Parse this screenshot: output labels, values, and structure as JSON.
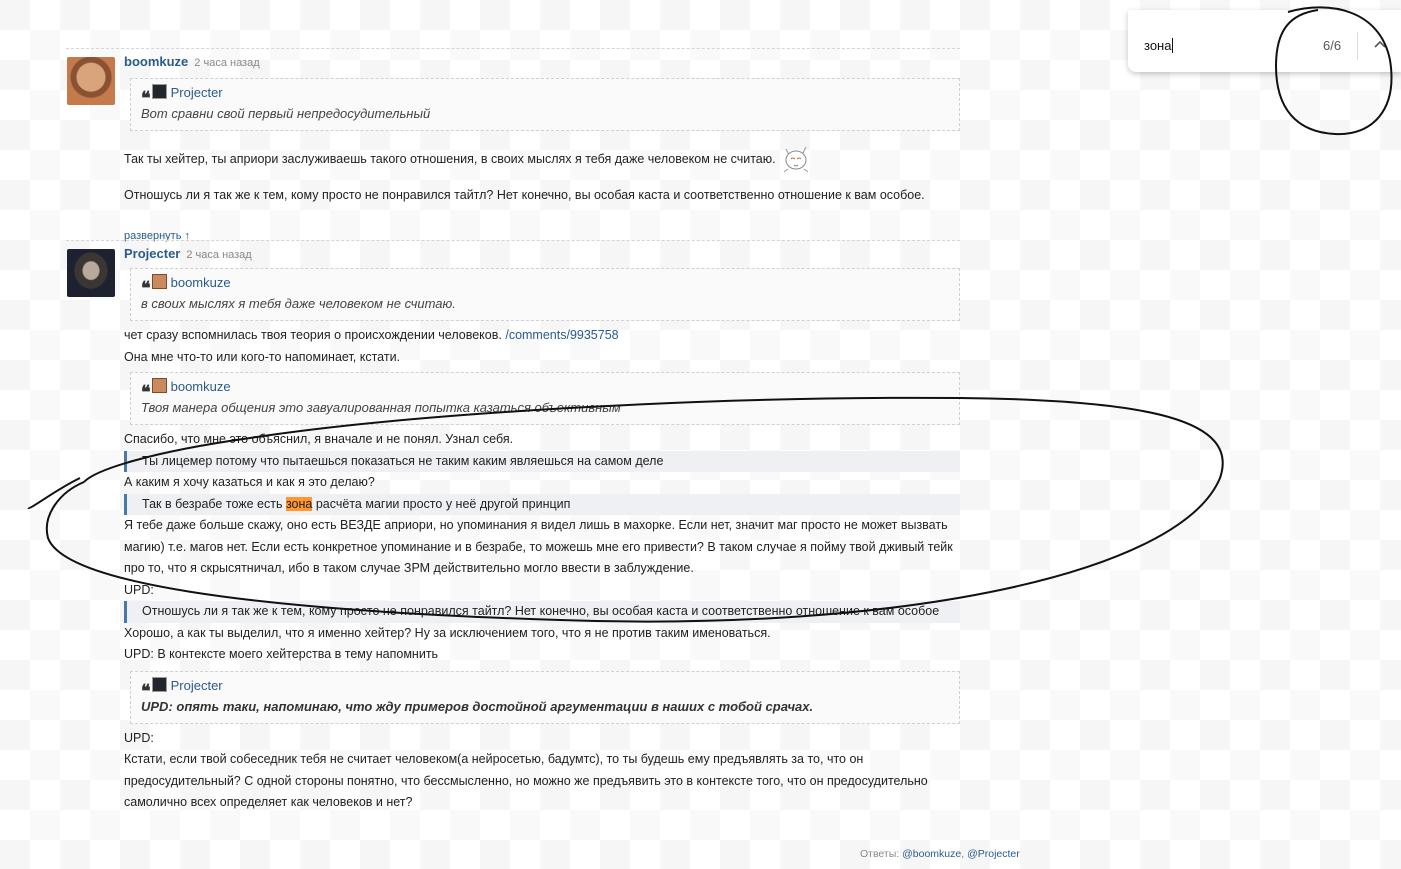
{
  "find_bar": {
    "query": "зона",
    "count": "6/6",
    "prev_icon": "chevron-up-icon"
  },
  "comments": [
    {
      "author": "boomkuze",
      "time": "2 часа назад",
      "quote": {
        "author": "Projecter",
        "text": "Вот сравни свой первый непредосудительный"
      },
      "paragraphs": [
        "Так ты хейтер, ты априори заслуживаешь такого отношения, в своих мыслях я тебя даже человеком не считаю.",
        "Отношусь ли я так же к тем, кому просто не понравился тайтл? Нет конечно, вы особая каста и соответственно отношение к вам особое."
      ],
      "expand_label": "развернуть ↑"
    },
    {
      "author": "Projecter",
      "time": "2 часа назад",
      "quote1": {
        "author": "boomkuze",
        "text": "в своих мыслях я тебя даже человеком не считаю."
      },
      "line1_text": "чет сразу вспомнилась твоя теория о происхождении человеков.",
      "line1_link": "/comments/9935758",
      "line2": "Она мне что-то или кого-то напоминает, кстати.",
      "quote2": {
        "author": "boomkuze",
        "text": "Твоя манера общения это завуалированная попытка казаться объективным"
      },
      "line3": "Спасибо, что мне это объяснил, я вначале и не понял. Узнал себя.",
      "bq1": "Ты лицемер потому что пытаешься показаться не таким каким являешься на самом деле",
      "line4": "А каким я хочу казаться и как я это делаю?",
      "bq2_before": "Так в безрабе тоже есть",
      "bq2_highlight": "зона",
      "bq2_after": "расчёта магии просто у неё другой принцип",
      "para5": "Я тебе даже больше скажу, оно есть ВЕЗДЕ априори, но упоминания я видел лишь в махорке. Если нет, значит маг просто не может вызвать магию) т.е. магов нет. Если есть конкретное упоминание и в безрабе, то можешь мне его привести? В таком случае я пойму твой дживый тейк про то, что я скрысятничал, ибо в таком случае ЗРМ действительно могло ввести в заблуждение.",
      "upd1": "UPD:",
      "bq3": "Отношусь ли я так же к тем, кому просто не понравился тайтл? Нет конечно, вы особая каста и соответственно отношение к вам особое",
      "line6": "Хорошо, а как ты выделил, что я именно хейтер? Ну за исключением того, что я не против таким именоваться.",
      "line7": "UPD: В контексте моего хейтерства в тему напомнить",
      "quote3": {
        "author": "Projecter",
        "text": "UPD: опять таки, напоминаю, что жду примеров достойной аргументации в наших с тобой срачах."
      },
      "upd2": "UPD:",
      "para8": "Кстати, если твой собеседник тебя не считает человеком(а нейросетью, бадумтс), то ты будешь ему предъявлять за то, что он предосудительный? С одной стороны понятно, что бессмысленно, но можно же предъявить это в контексте того, что он предосудительно самолично всех определяет как человеков и нет?",
      "replies_label": "Ответы:",
      "replies": [
        "@boomkuze",
        "@Projecter"
      ]
    }
  ]
}
